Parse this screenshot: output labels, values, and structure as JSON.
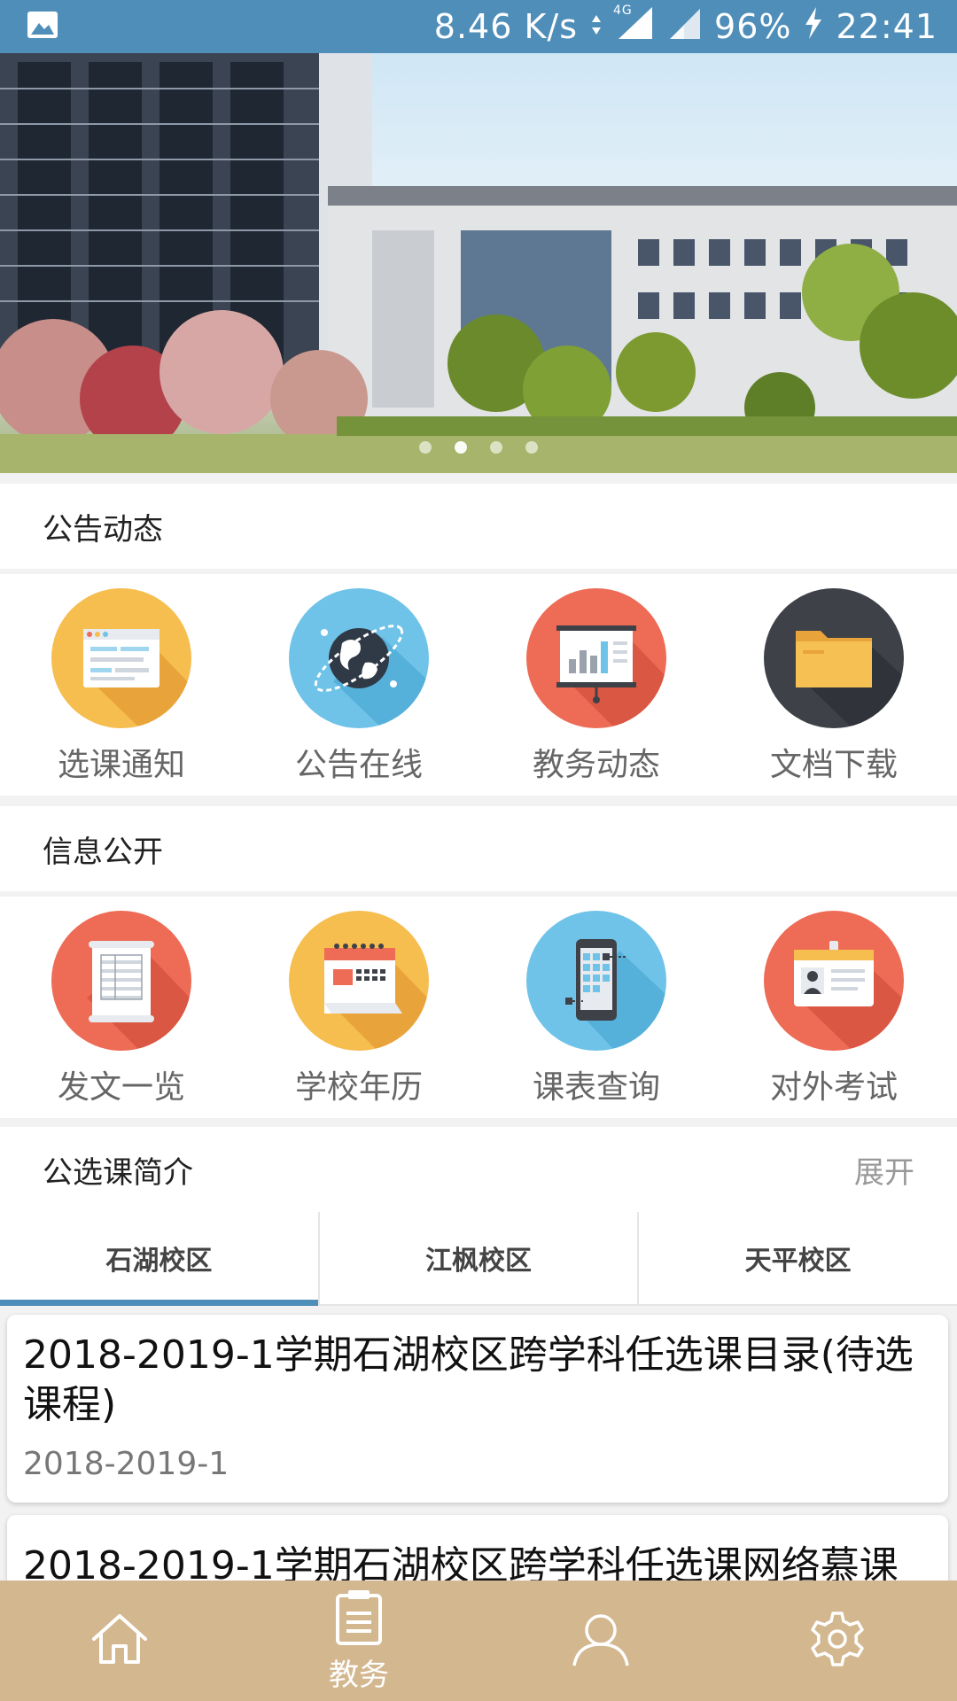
{
  "status_bar": {
    "speed": "8.46 K/s",
    "network": "4G",
    "battery": "96%",
    "time": "22:41"
  },
  "banner": {
    "slides": 4,
    "active_slide": 1
  },
  "announcements": {
    "title": "公告动态",
    "items": [
      {
        "label": "选课通知",
        "icon": "course-notice-icon",
        "color": "#f6bd4f"
      },
      {
        "label": "公告在线",
        "icon": "globe-icon",
        "color": "#6fc3e8"
      },
      {
        "label": "教务动态",
        "icon": "presentation-chart-icon",
        "color": "#ee6b55"
      },
      {
        "label": "文档下载",
        "icon": "folder-icon",
        "color": "#3e4148"
      }
    ]
  },
  "info": {
    "title": "信息公开",
    "items": [
      {
        "label": "发文一览",
        "icon": "document-list-icon",
        "color": "#ee6b55"
      },
      {
        "label": "学校年历",
        "icon": "calendar-icon",
        "color": "#f6bd4f"
      },
      {
        "label": "课表查询",
        "icon": "phone-schedule-icon",
        "color": "#6fc3e8"
      },
      {
        "label": "对外考试",
        "icon": "id-card-icon",
        "color": "#ee6b55"
      }
    ]
  },
  "courses": {
    "title": "公选课简介",
    "expand_label": "展开",
    "tabs": [
      "石湖校区",
      "江枫校区",
      "天平校区"
    ],
    "active_tab": 0,
    "cards": [
      {
        "title": "2018-2019-1学期石湖校区跨学科任选课目录(待选课程)",
        "term": "2018-2019-1"
      },
      {
        "title": "2018-2019-1学期石湖校区跨学科任选课网络慕课",
        "term": ""
      }
    ]
  },
  "bottom_nav": {
    "items": [
      {
        "icon": "home-icon",
        "label": ""
      },
      {
        "icon": "clipboard-icon",
        "label": "教务"
      },
      {
        "icon": "user-icon",
        "label": ""
      },
      {
        "icon": "gear-icon",
        "label": ""
      }
    ],
    "active": 1
  },
  "colors": {
    "status_bar": "#4f8eb9",
    "bottom_bar": "#d3b78f",
    "tab_indicator": "#4f8eb9"
  }
}
